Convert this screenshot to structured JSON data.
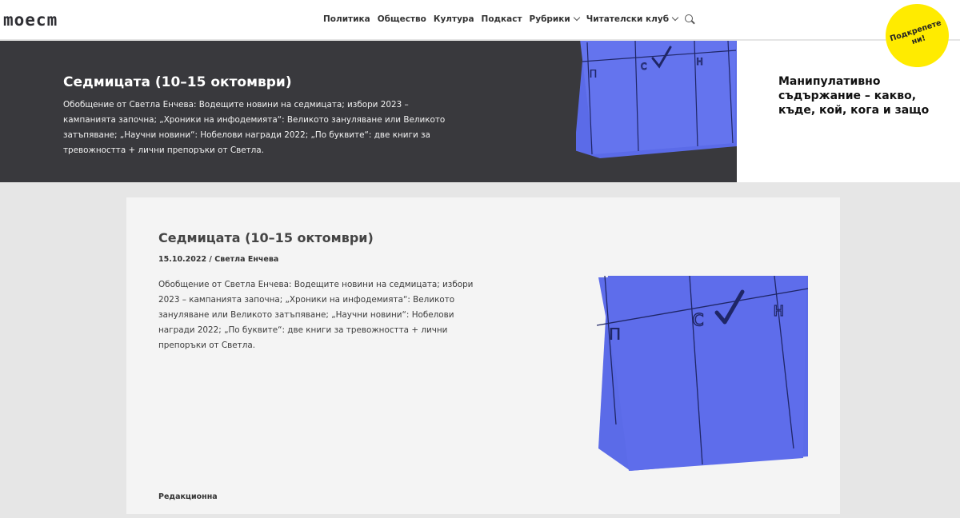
{
  "header": {
    "logo": "moecm",
    "nav": [
      {
        "label": "Политика"
      },
      {
        "label": "Общество"
      },
      {
        "label": "Култура"
      },
      {
        "label": "Подкаст"
      },
      {
        "label": "Рубрики",
        "dropdown": true
      },
      {
        "label": "Читателски клуб",
        "dropdown": true
      }
    ],
    "support_label": "Подкрепете ни!"
  },
  "hero": {
    "title": "Седмицата (10–15 октомври)",
    "excerpt": "Обобщение от Светла Енчева: Водещите новини на седмицата; избори 2023 – кампанията започна; „Хроники на инфодемията“: Великото зануляване или Великото затъпяване; „Научни новини“: Нобелови награди 2022; „По буквите“: две книги за тревожността + лични препоръки от Светла."
  },
  "aside": {
    "text": "Манипулативно съдържание – какво, къде, кой, кога и защо"
  },
  "article": {
    "title": "Седмицата (10–15 октомври)",
    "date": "15.10.2022",
    "separator": "/",
    "author": "Светла Енчева",
    "excerpt": "Обобщение от Светла Енчева: Водещите новини на седмицата; избори 2023 – кампанията започна; „Хроники на инфодемията“: Великото зануляване или Великото затъпяване; „Научни новини“: Нобелови награди 2022; „По буквите“: две книги за тревожността + лични препоръки от Светла.",
    "category": "Редакционна"
  },
  "illustration": {
    "letters": [
      "п",
      "с",
      "н"
    ],
    "colors": {
      "paper": "#5b6be8",
      "ink": "#1f2666",
      "accent_yellow": "#ffeb00",
      "hero_bg": "#39393d"
    }
  }
}
